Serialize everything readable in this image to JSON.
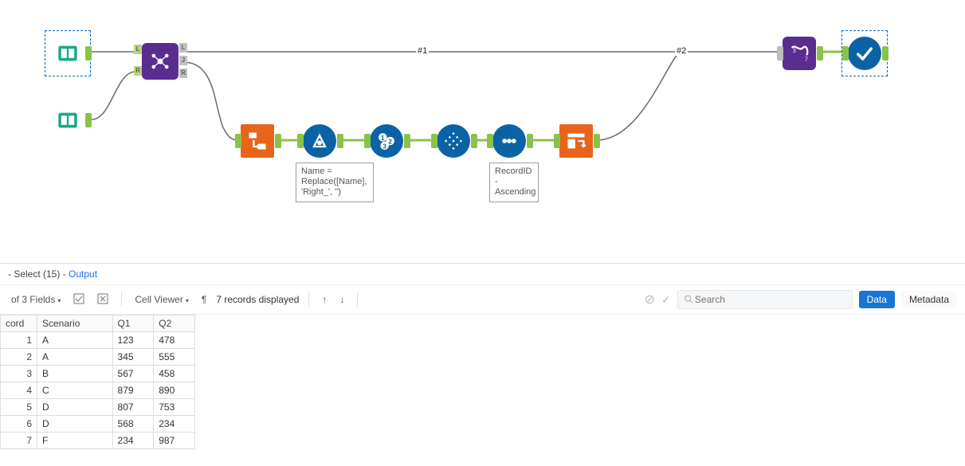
{
  "canvas": {
    "labels": {
      "wire1": "#1",
      "wire2": "#2"
    },
    "annotations": {
      "formula": "Name = Replace([Name], 'Right_', '')",
      "sort": "RecordID - Ascending"
    },
    "tools": {
      "input1": "text-input-1",
      "input2": "text-input-2",
      "join": "join",
      "transpose": "transpose",
      "formula": "formula",
      "recordid": "record-id",
      "tile": "tile",
      "sort": "sort",
      "crosstab": "cross-tab",
      "select": "select",
      "browse": "browse"
    }
  },
  "results": {
    "title_prefix": "- Select (15) -",
    "title_node": "Output",
    "fields_label": "of 3 Fields",
    "cell_viewer_label": "Cell Viewer",
    "records_label": "7 records displayed",
    "search_placeholder": "Search",
    "tab_data": "Data",
    "tab_metadata": "Metadata",
    "columns": [
      "cord",
      "Scenario",
      "Q1",
      "Q2"
    ],
    "rows": [
      {
        "idx": 1,
        "scenario": "A",
        "q1": "123",
        "q2": "478"
      },
      {
        "idx": 2,
        "scenario": "A",
        "q1": "345",
        "q2": "555"
      },
      {
        "idx": 3,
        "scenario": "B",
        "q1": "567",
        "q2": "458"
      },
      {
        "idx": 4,
        "scenario": "C",
        "q1": "879",
        "q2": "890"
      },
      {
        "idx": 5,
        "scenario": "D",
        "q1": "807",
        "q2": "753"
      },
      {
        "idx": 6,
        "scenario": "D",
        "q1": "568",
        "q2": "234"
      },
      {
        "idx": 7,
        "scenario": "F",
        "q1": "234",
        "q2": "987"
      }
    ]
  }
}
